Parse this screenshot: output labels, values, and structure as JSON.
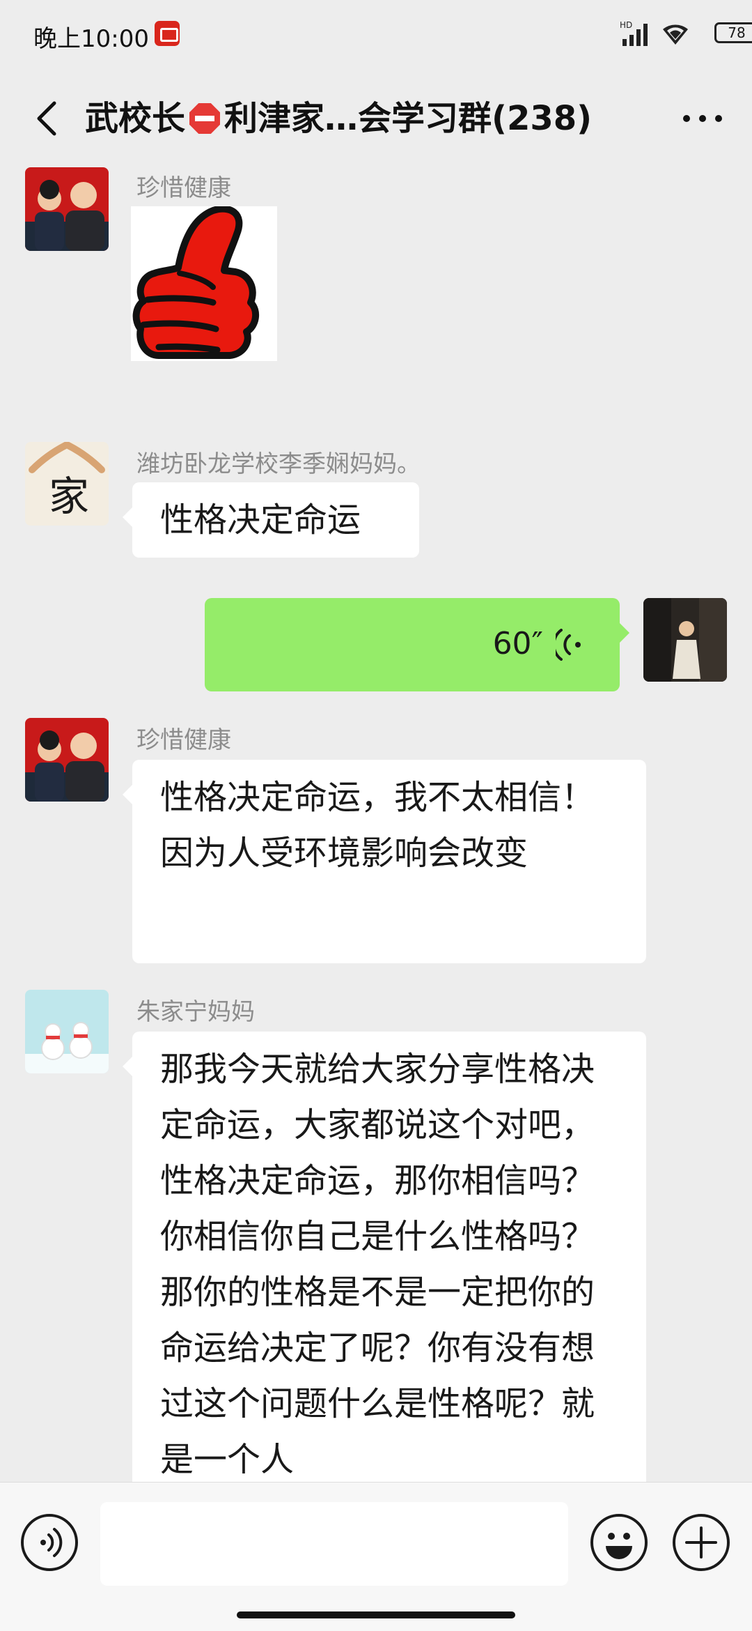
{
  "status_bar": {
    "time": "晚上10:00",
    "signal_badge": "HD",
    "battery": "78"
  },
  "nav": {
    "title_part1": "武校长",
    "title_part2": "利津家…会学习群(238)"
  },
  "messages": [
    {
      "sender": "珍惜健康",
      "type": "sticker",
      "sticker": "thumbs-up"
    },
    {
      "sender": "潍坊卧龙学校李季娴妈妈。",
      "type": "text",
      "text": "性格决定命运"
    },
    {
      "sender": "self",
      "type": "voice",
      "duration": "60″"
    },
    {
      "sender": "珍惜健康",
      "type": "text",
      "text": "性格决定命运，我不太相信！因为人受环境影响会改变"
    },
    {
      "sender": "朱家宁妈妈",
      "type": "text",
      "text": "那我今天就给大家分享性格决定命运，大家都说这个对吧，性格决定命运，那你相信吗？你相信你自己是什么性格吗？那你的性格是不是一定把你的命运给决定了呢？你有没有想过这个问题什么是性格呢？就是一个人"
    }
  ],
  "input_bar": {
    "text_value": ""
  },
  "colors": {
    "background": "#ededed",
    "outgoing_bubble": "#95ec69",
    "incoming_bubble": "#ffffff",
    "sticker_red": "#e8190e"
  }
}
